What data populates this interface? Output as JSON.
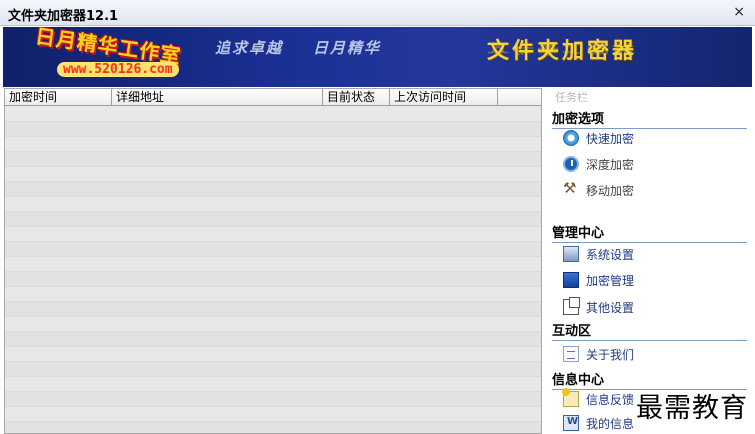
{
  "window": {
    "title": "文件夹加密器12.1",
    "close_glyph": "×"
  },
  "banner": {
    "logo_title": "日月精华工作室",
    "logo_url": "www.520126.com",
    "slogans": [
      "追求卓越",
      "日月精华"
    ],
    "brand": "文件夹加密器"
  },
  "table": {
    "columns": [
      "加密时间",
      "详细地址",
      "目前状态",
      "上次访问时间",
      ""
    ],
    "rows": []
  },
  "panel": {
    "header": "任务栏",
    "sections": {
      "encrypt_options": {
        "title": "加密选项",
        "items": [
          {
            "label": "快速加密",
            "icon": "quick-encrypt-icon"
          },
          {
            "label": "深度加密",
            "icon": "deep-encrypt-icon"
          },
          {
            "label": "移动加密",
            "icon": "tools-icon"
          }
        ]
      },
      "management": {
        "title": "管理中心",
        "items": [
          {
            "label": "系统设置",
            "icon": "system-settings-icon"
          },
          {
            "label": "加密管理",
            "icon": "encrypt-manage-icon"
          },
          {
            "label": "其他设置",
            "icon": "other-settings-icon"
          }
        ]
      },
      "interaction": {
        "title": "互动区",
        "items": [
          {
            "label": "关于我们",
            "icon": "document-icon"
          }
        ]
      },
      "info_center": {
        "title": "信息中心",
        "items": [
          {
            "label": "信息反馈",
            "icon": "feedback-icon"
          },
          {
            "label": "我的信息",
            "icon": "word-doc-icon"
          }
        ]
      }
    }
  },
  "watermark": "最需教育",
  "colors": {
    "banner": "#1b3196",
    "link": "#223a84",
    "section_rule": "#7f9cc8"
  }
}
